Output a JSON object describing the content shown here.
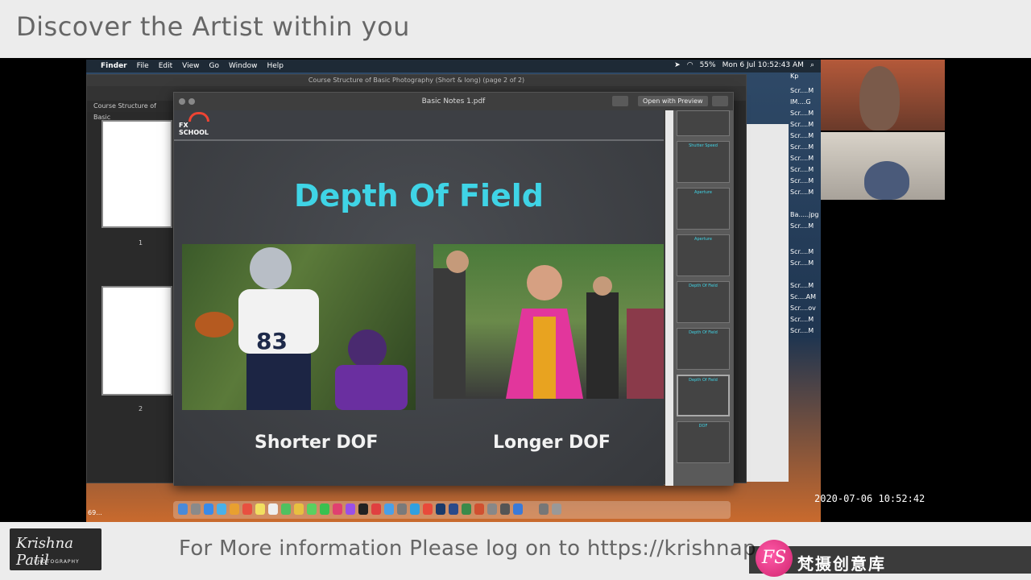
{
  "banner": {
    "title": "Discover the Artist within you"
  },
  "menubar": {
    "items": [
      "Finder",
      "File",
      "Edit",
      "View",
      "Go",
      "Window",
      "Help"
    ],
    "battery": "55%",
    "datetime": "Mon 6 Jul  10:52:43 AM"
  },
  "preview_window": {
    "title": "Course Structure of Basic Photography (Short & long) (page 2 of 2)",
    "sidebar_header": "Course Structure of Basic",
    "page_numbers": [
      "1",
      "2"
    ]
  },
  "pdf_window": {
    "title": "Basic Notes 1.pdf",
    "open_button": "Open with Preview",
    "logo_text": "FX SCHOOL",
    "slide_heading": "Depth Of Field",
    "caption_left": "Shorter DOF",
    "caption_right": "Longer DOF",
    "thumbnails": [
      "",
      "Shutter Speed",
      "Aperture",
      "Aperture",
      "Depth Of Field",
      "Depth Of Field",
      "Depth Of Field",
      "DOF"
    ]
  },
  "desktop_icons": [
    "Scr....M",
    "IM....G",
    "Scr....M",
    "Scr....M",
    "Scr....M",
    "Scr....M",
    "Scr....M",
    "Scr....M",
    "Scr....M",
    "Scr....M",
    "Ba.....jpg",
    "Scr....M",
    "Scr....M",
    "Scr....M",
    "Scr....M",
    "Sc....AM",
    "Scr....ov",
    "Scr....M",
    "Scr....M"
  ],
  "desktop_folder": "69...",
  "kp_label": "Kp",
  "timestamp": "2020-07-06  10:52:42",
  "footer": {
    "logo_signature": "Krishna Patil",
    "logo_sub": "PHOTOGRAPHY",
    "info_text": "For More information Please log on to https://krishnap"
  },
  "watermark": {
    "text": "梵摄创意库",
    "badge": "FS"
  }
}
